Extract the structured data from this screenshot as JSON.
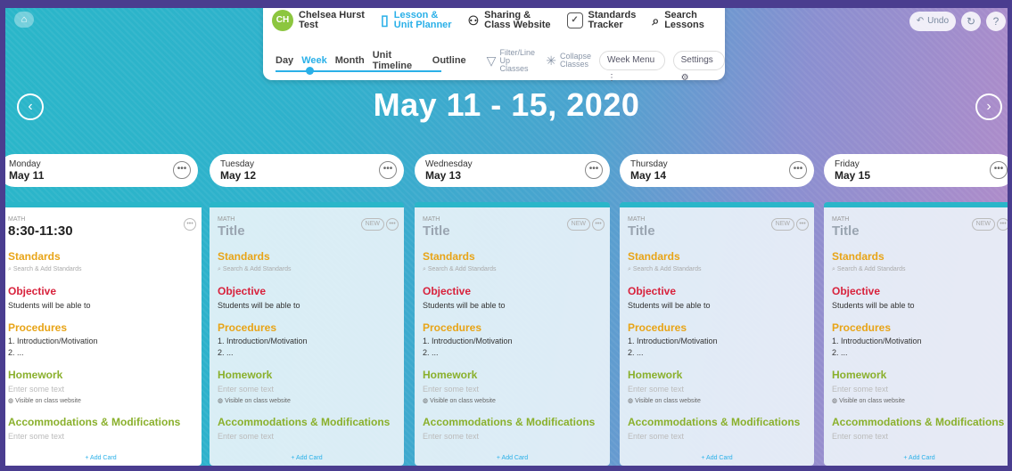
{
  "top": {
    "left_icon": "home-icon",
    "undo_label": "Undo",
    "refresh_icon": "↻",
    "help_icon": "?"
  },
  "toolbar": {
    "avatar_initials": "CH",
    "user_name_line1": "Chelsea Hurst",
    "user_name_line2": "Test",
    "planner_line1": "Lesson &",
    "planner_line2": "Unit Planner",
    "sharing_line1": "Sharing &",
    "sharing_line2": "Class Website",
    "tracker_line1": "Standards",
    "tracker_line2": "Tracker",
    "search_line1": "Search",
    "search_line2": "Lessons",
    "views": [
      "Day",
      "Week",
      "Month",
      "Unit Timeline",
      "Outline"
    ],
    "filter_line1": "Filter/Line Up",
    "filter_line2": "Classes",
    "collapse_line1": "Collapse",
    "collapse_line2": "Classes",
    "week_menu": "Week Menu",
    "settings": "Settings"
  },
  "week_title": "May 11 - 15, 2020",
  "labels": {
    "standards": "Standards",
    "search_standards": "Search & Add Standards",
    "objective": "Objective",
    "objective_text": "Students will be able to",
    "procedures": "Procedures",
    "proc1": "1. Introduction/Motivation",
    "proc2": "2. ...",
    "homework": "Homework",
    "enter_text": "Enter some text",
    "visible": "Visible on class website",
    "accommodations": "Accommodations & Modifications",
    "add_card": "+ Add Card",
    "new_chip": "NEW",
    "dots": "•••"
  },
  "days": [
    {
      "name": "Monday",
      "date": "May 11",
      "subject": "MATH",
      "title": "8:30-11:30"
    },
    {
      "name": "Tuesday",
      "date": "May 12",
      "subject": "MATH",
      "title": "Title"
    },
    {
      "name": "Wednesday",
      "date": "May 13",
      "subject": "MATH",
      "title": "Title"
    },
    {
      "name": "Thursday",
      "date": "May 14",
      "subject": "MATH",
      "title": "Title"
    },
    {
      "name": "Friday",
      "date": "May 15",
      "subject": "MATH",
      "title": "Title"
    }
  ]
}
